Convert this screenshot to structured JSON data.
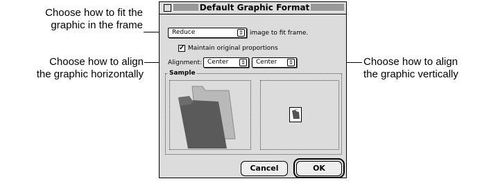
{
  "callouts": {
    "fit_line1": "Choose how to fit the",
    "fit_line2": "graphic in the frame",
    "halign_line1": "Choose how to align",
    "halign_line2": "the graphic horizontally",
    "valign_line1": "Choose how to align",
    "valign_line2": "the graphic vertically"
  },
  "dialog": {
    "title": "Default Graphic Format",
    "fit_popup_value": "Reduce",
    "fit_suffix": "image to fit frame.",
    "maintain_checked": true,
    "maintain_label": "Maintain original proportions",
    "alignment_label": "Alignment:",
    "h_align_value": "Center",
    "v_align_value": "Center",
    "sample_label": "Sample",
    "cancel_label": "Cancel",
    "ok_label": "OK"
  }
}
